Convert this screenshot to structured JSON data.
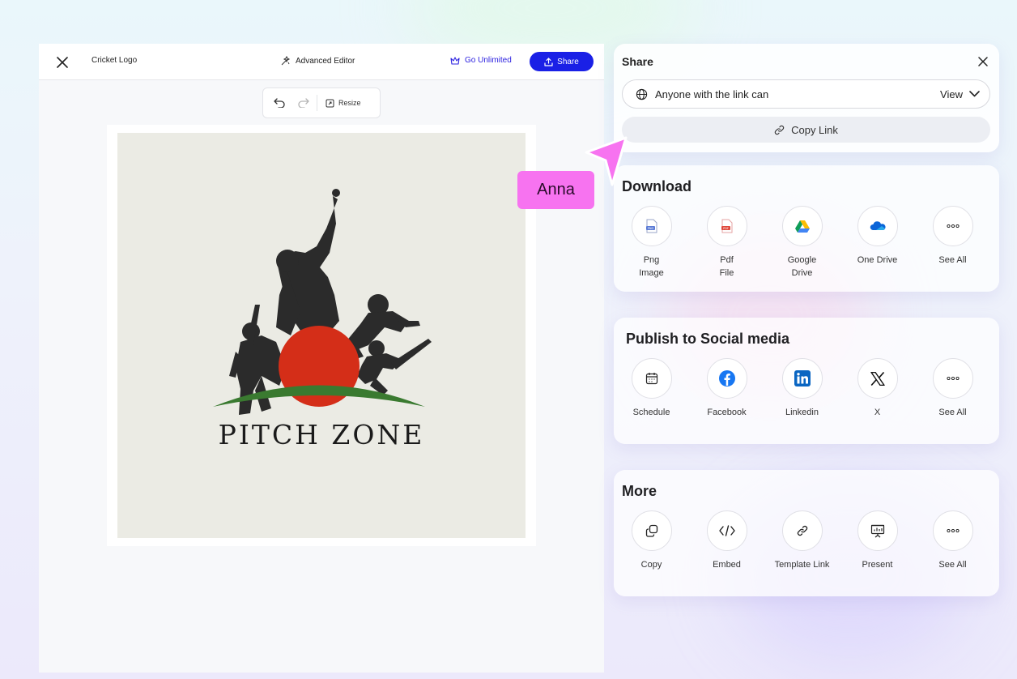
{
  "editor": {
    "doc_title": "Cricket Logo",
    "advanced_editor": "Advanced Editor",
    "go_unlimited": "Go Unlimited",
    "share_button": "Share",
    "resize_label": "Resize",
    "logo_text": "PITCH ZONE"
  },
  "share": {
    "title": "Share",
    "permission_text": "Anyone with the link can",
    "permission_value": "View",
    "copy_link": "Copy Link"
  },
  "download": {
    "title": "Download",
    "items": [
      {
        "label": "Png\nImage",
        "icon": "png-file-icon"
      },
      {
        "label": "Pdf\nFile",
        "icon": "pdf-file-icon"
      },
      {
        "label": "Google\nDrive",
        "icon": "google-drive-icon"
      },
      {
        "label": "One Drive",
        "icon": "onedrive-icon"
      },
      {
        "label": "See All",
        "icon": "more-icon"
      }
    ]
  },
  "social": {
    "title": "Publish to Social media",
    "items": [
      {
        "label": "Schedule",
        "icon": "calendar-icon"
      },
      {
        "label": "Facebook",
        "icon": "facebook-icon"
      },
      {
        "label": "Linkedin",
        "icon": "linkedin-icon"
      },
      {
        "label": "X",
        "icon": "x-icon"
      },
      {
        "label": "See All",
        "icon": "more-icon"
      }
    ]
  },
  "more": {
    "title": "More",
    "items": [
      {
        "label": "Copy",
        "icon": "copy-icon"
      },
      {
        "label": "Embed",
        "icon": "code-icon"
      },
      {
        "label": "Template Link",
        "icon": "link-icon"
      },
      {
        "label": "Present",
        "icon": "present-icon"
      },
      {
        "label": "See All",
        "icon": "more-icon"
      }
    ]
  },
  "collaborator": {
    "name": "Anna",
    "color": "#f773f0"
  },
  "colors": {
    "accent": "#1a20e6",
    "sun": "#d42e18",
    "grass": "#3a7a30"
  }
}
